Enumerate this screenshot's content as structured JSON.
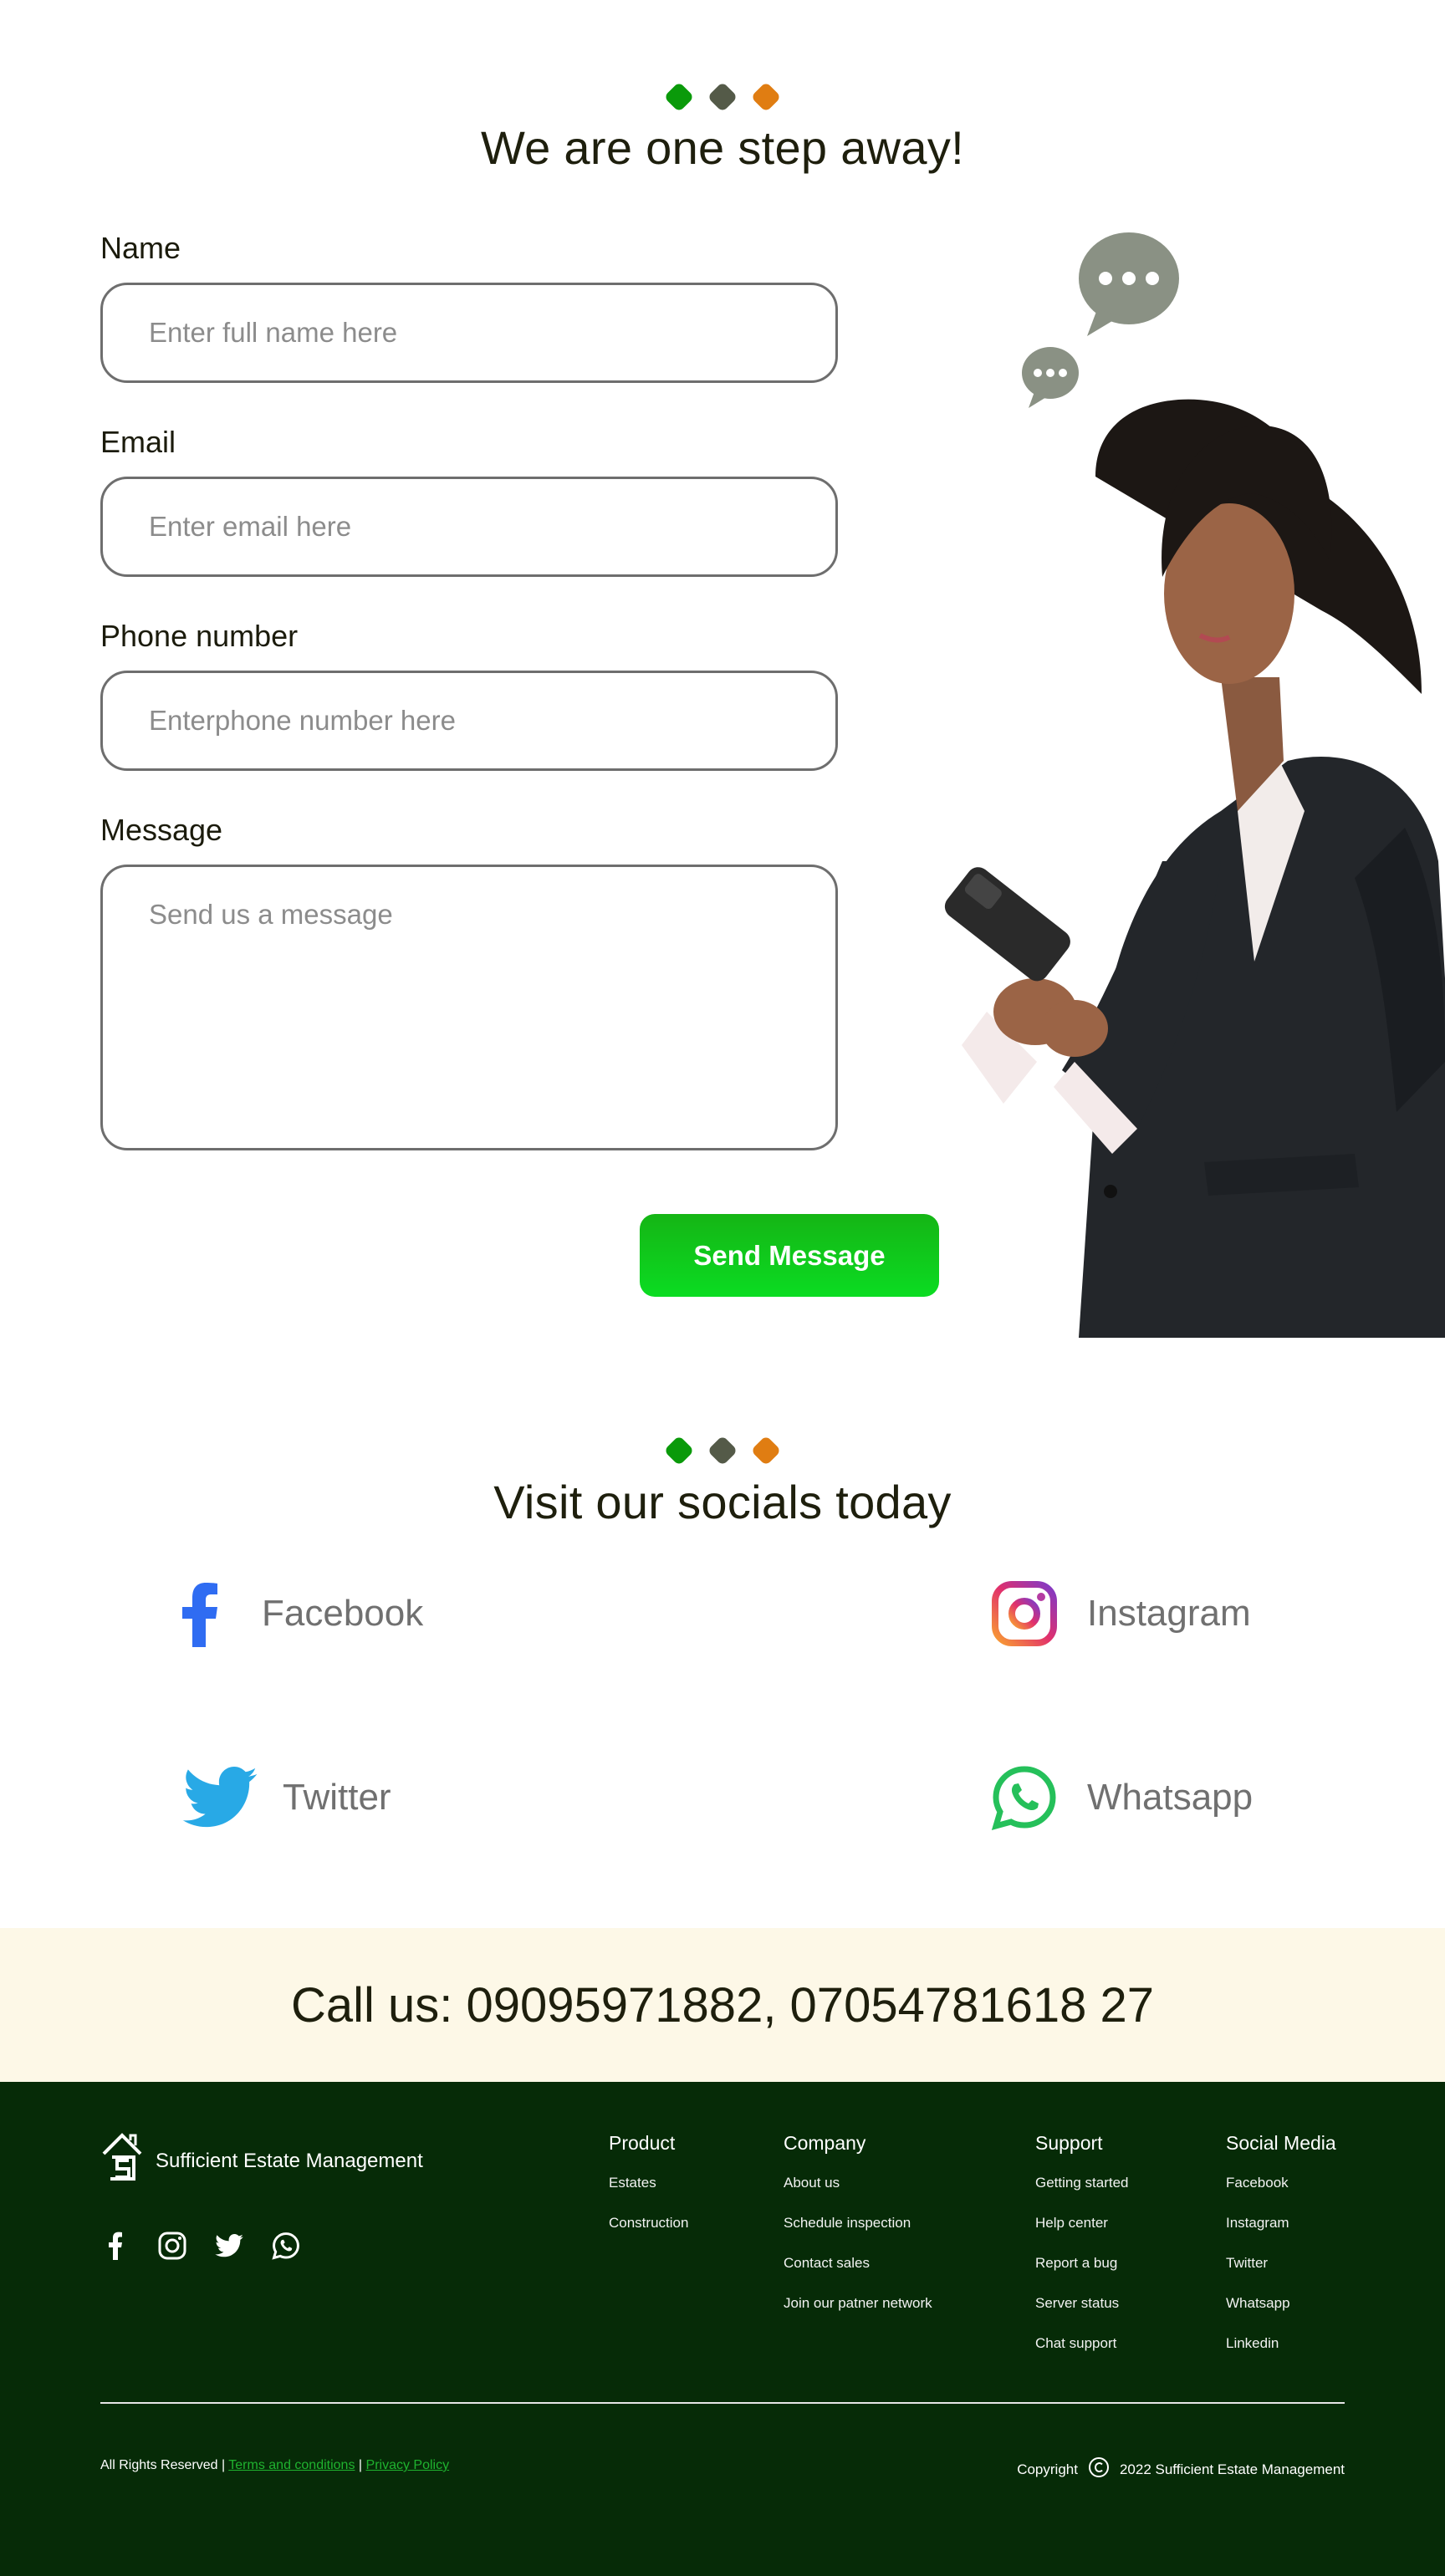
{
  "colors": {
    "accent_green": "#0a9a0a",
    "accent_gray": "#545a48",
    "accent_orange": "#e07d12",
    "footer_bg": "#062b07",
    "call_bg": "#fdf8e7"
  },
  "contact": {
    "title": "We are one step away!",
    "fields": [
      {
        "label": "Name",
        "placeholder": "Enter full name here"
      },
      {
        "label": "Email",
        "placeholder": "Enter email here"
      },
      {
        "label": "Phone number",
        "placeholder": "Enterphone number here"
      },
      {
        "label": "Message",
        "placeholder": "Send us a message"
      }
    ],
    "submit_label": "Send Message"
  },
  "socials": {
    "title": "Visit our socials today",
    "items": [
      {
        "label": "Facebook",
        "icon": "facebook-icon"
      },
      {
        "label": "Instagram",
        "icon": "instagram-icon"
      },
      {
        "label": "Twitter",
        "icon": "twitter-icon"
      },
      {
        "label": "Whatsapp",
        "icon": "whatsapp-icon"
      }
    ]
  },
  "call": {
    "text": "Call us: 09095971882, 07054781618 27"
  },
  "footer": {
    "brand": "Sufficient Estate Management",
    "columns": [
      {
        "title": "Product",
        "links": [
          "Estates",
          "Construction"
        ]
      },
      {
        "title": "Company",
        "links": [
          "About us",
          "Schedule inspection",
          "Contact sales",
          "Join our patner network"
        ]
      },
      {
        "title": "Support",
        "links": [
          "Getting started",
          "Help center",
          "Report a bug",
          "Server status",
          "Chat support"
        ]
      },
      {
        "title": "Social Media",
        "links": [
          "Facebook",
          "Instagram",
          "Twitter",
          "Whatsapp",
          "Linkedin"
        ]
      }
    ],
    "rights_text": "All Rights Reserved |",
    "terms_label": "Terms and conditions",
    "separator": "|",
    "privacy_label": "Privacy Policy",
    "copyright_label": "Copyright",
    "copyright_text": "2022 Sufficient Estate Management"
  }
}
